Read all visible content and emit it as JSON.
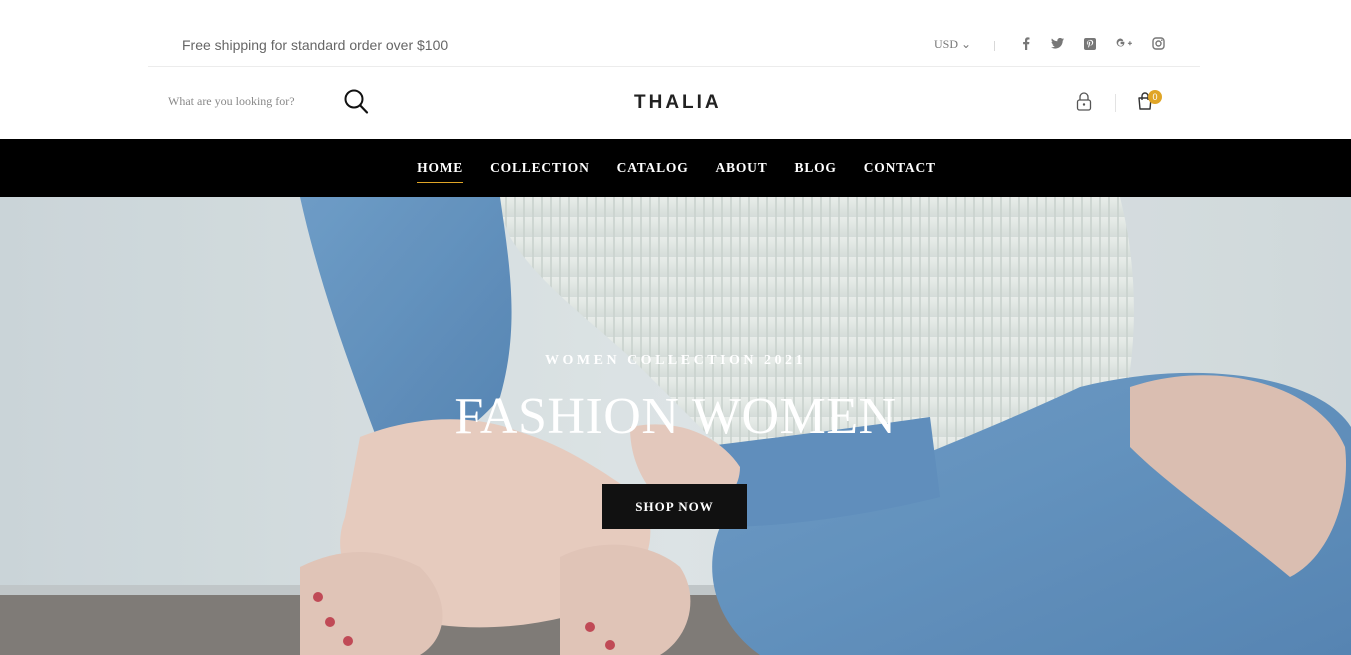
{
  "topbar": {
    "shipping_text": "Free shipping for standard order over $100",
    "currency": "USD",
    "social": [
      {
        "icon": "facebook-icon",
        "glyph": "f"
      },
      {
        "icon": "twitter-icon",
        "glyph": "t"
      },
      {
        "icon": "pinterest-icon",
        "glyph": "p"
      },
      {
        "icon": "google-plus-icon",
        "glyph": "G+"
      },
      {
        "icon": "instagram-icon",
        "glyph": "ig"
      }
    ]
  },
  "header": {
    "search_placeholder": "What are you looking for?",
    "logo": "THALIA",
    "cart_count": "0"
  },
  "nav": {
    "items": [
      "HOME",
      "COLLECTION",
      "CATALOG",
      "ABOUT",
      "BLOG",
      "CONTACT"
    ],
    "active": "HOME"
  },
  "hero": {
    "eyebrow": "WOMEN COLLECTION 2021",
    "headline": "FASHION WOMEN",
    "cta": "SHOP NOW"
  },
  "colors": {
    "accent": "#e0a526",
    "nav_bg": "#000000",
    "button_bg": "#111111"
  }
}
